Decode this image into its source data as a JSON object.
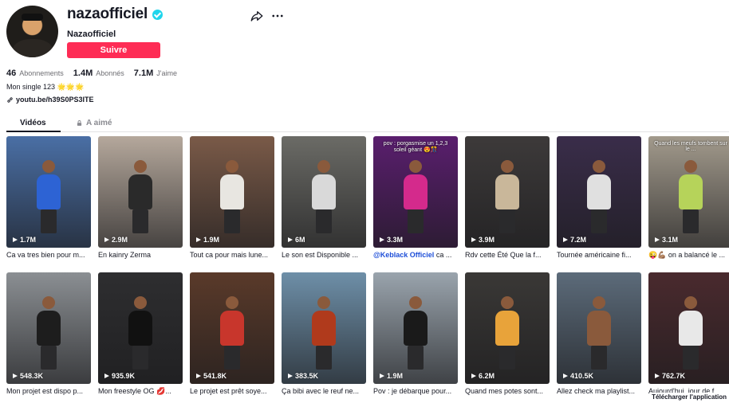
{
  "profile": {
    "username": "nazaofficiel",
    "nickname": "Nazaofficiel",
    "follow_label": "Suivre",
    "stats": [
      {
        "value": "46",
        "label": "Abonnements"
      },
      {
        "value": "1.4M",
        "label": "Abonnés"
      },
      {
        "value": "7.1M",
        "label": "J'aime"
      }
    ],
    "bio": "Mon single 123 🌟🌟🌟",
    "link": "youtu.be/h39S0PS3ITE"
  },
  "tabs": {
    "videos": "Vidéos",
    "liked": "A aimé"
  },
  "videos": [
    {
      "views": "1.7M",
      "caption": "Ca va tres bien pour m...",
      "bg": "#4a6fa5",
      "accent": "#2d63d4"
    },
    {
      "views": "2.9M",
      "caption": "En kainry Zerma",
      "bg": "#b5a89c",
      "accent": "#2a2a2a"
    },
    {
      "views": "1.9M",
      "caption": "Tout ca pour mais lune...",
      "bg": "#7a5a48",
      "accent": "#e8e6e1"
    },
    {
      "views": "6M",
      "caption": "Le son est Disponible ...",
      "bg": "#6b6b66",
      "accent": "#d9d9d9"
    },
    {
      "views": "3.3M",
      "caption_mention": "@Keblack Officiel",
      "caption": " ca ...",
      "overlay": "pov : porgasmise un 1,2,3 soleil géant 😍🎊",
      "bg": "#5a1e6e",
      "accent": "#d42a8c"
    },
    {
      "views": "3.9M",
      "caption": "Rdv cette Été Que la f...",
      "bg": "#3d3a3a",
      "accent": "#c9b79a"
    },
    {
      "views": "7.2M",
      "caption": "Tournée américaine fi...",
      "bg": "#3a2d4a",
      "accent": "#e0e0e0"
    },
    {
      "views": "3.1M",
      "caption": "😜💪🏽 on a balancé le ...",
      "overlay": "Quand les meufs tombent sur le ...",
      "bg": "#a29a8c",
      "accent": "#b6d35a"
    },
    {
      "views": "548.3K",
      "caption": "Mon projet est dispo p...",
      "bg": "#8b8f93",
      "accent": "#1d1d1d"
    },
    {
      "views": "935.9K",
      "caption": "Mon freestyle OG 💋...",
      "bg": "#2e2e30",
      "accent": "#111111"
    },
    {
      "views": "541.8K",
      "caption": "Le projet est prêt soye...",
      "bg": "#5a3a2a",
      "accent": "#c8362c"
    },
    {
      "views": "383.5K",
      "caption": "Ça bibi avec le reuf ne...",
      "bg": "#6e8fa8",
      "accent": "#b03a1c"
    },
    {
      "views": "1.9M",
      "caption": "Pov : je débarque pour...",
      "bg": "#9aa4ad",
      "accent": "#1a1a1a"
    },
    {
      "views": "6.2M",
      "caption": "Quand mes potes sont...",
      "bg": "#3a3836",
      "accent": "#e8a33a"
    },
    {
      "views": "410.5K",
      "caption": "Allez check ma playlist...",
      "bg": "#5c6b7a",
      "accent": "#8a5a3c"
    },
    {
      "views": "762.7K",
      "caption": "Aujourd'hui, jour de f...",
      "bg": "#4a2a2e",
      "accent": "#e8e8e8"
    }
  ],
  "download_label": "Télécharger l'application"
}
